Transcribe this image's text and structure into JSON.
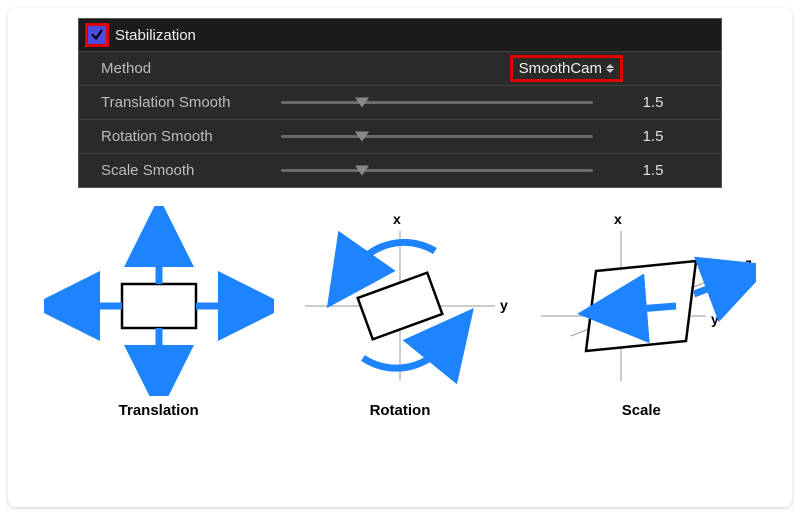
{
  "panel": {
    "title": "Stabilization",
    "checkbox_checked": true,
    "method": {
      "label": "Method",
      "value": "SmoothCam"
    },
    "rows": [
      {
        "label": "Translation Smooth",
        "value": "1.5",
        "slider_pct": 26
      },
      {
        "label": "Rotation Smooth",
        "value": "1.5",
        "slider_pct": 26
      },
      {
        "label": "Scale Smooth",
        "value": "1.5",
        "slider_pct": 26
      }
    ]
  },
  "diagrams": {
    "axes": {
      "x": "x",
      "y": "y",
      "z": "z"
    },
    "items": [
      {
        "caption": "Translation"
      },
      {
        "caption": "Rotation"
      },
      {
        "caption": "Scale"
      }
    ]
  }
}
